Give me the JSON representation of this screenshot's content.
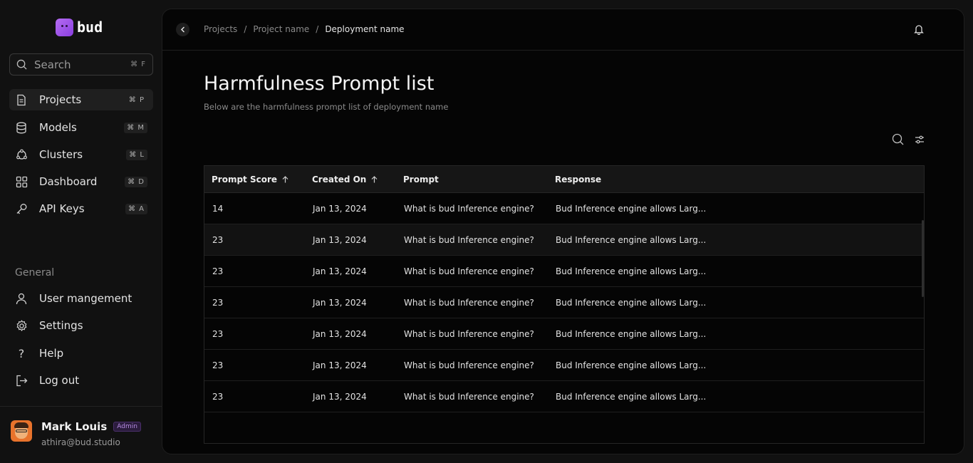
{
  "app": {
    "logo_text": "bud"
  },
  "sidebar": {
    "search": {
      "label": "Search",
      "shortcut": "⌘ F"
    },
    "items": [
      {
        "label": "Projects",
        "shortcut": "⌘ P",
        "icon": "document-icon",
        "active": true
      },
      {
        "label": "Models",
        "shortcut": "⌘ M",
        "icon": "database-icon"
      },
      {
        "label": "Clusters",
        "shortcut": "⌘ L",
        "icon": "cluster-icon"
      },
      {
        "label": "Dashboard",
        "shortcut": "⌘ D",
        "icon": "grid-icon"
      },
      {
        "label": "API Keys",
        "shortcut": "⌘ A",
        "icon": "key-icon"
      }
    ],
    "section_label": "General",
    "general_items": [
      {
        "label": "User mangement",
        "icon": "user-icon"
      },
      {
        "label": "Settings",
        "icon": "gear-icon"
      },
      {
        "label": "Help",
        "icon": "question-icon"
      },
      {
        "label": "Log out",
        "icon": "logout-icon"
      }
    ],
    "profile": {
      "name": "Mark Louis",
      "role": "Admin",
      "email": "athira@bud.studio"
    }
  },
  "header": {
    "breadcrumb": [
      "Projects",
      "Project name",
      "Deployment name"
    ],
    "separator": "/"
  },
  "main": {
    "title": "Harmfulness Prompt list",
    "subtitle": "Below are the harmfulness prompt list of deployment name"
  },
  "table": {
    "columns": [
      "Prompt Score",
      "Created On",
      "Prompt",
      "Response"
    ],
    "rows": [
      [
        "14",
        "Jan 13, 2024",
        "What is bud Inference engine?",
        "Bud Inference engine allows Larg..."
      ],
      [
        "23",
        "Jan 13, 2024",
        "What is bud Inference engine?",
        "Bud Inference engine allows Larg..."
      ],
      [
        "23",
        "Jan 13, 2024",
        "What is bud Inference engine?",
        "Bud Inference engine allows Larg..."
      ],
      [
        "23",
        "Jan 13, 2024",
        "What is bud Inference engine?",
        "Bud Inference engine allows Larg..."
      ],
      [
        "23",
        "Jan 13, 2024",
        "What is bud Inference engine?",
        "Bud Inference engine allows Larg..."
      ],
      [
        "23",
        "Jan 13, 2024",
        "What is bud Inference engine?",
        "Bud Inference engine allows Larg..."
      ],
      [
        "23",
        "Jan 13, 2024",
        "What is bud Inference engine?",
        "Bud Inference engine allows Larg..."
      ]
    ]
  },
  "colors": {
    "accent": "#9B4DEB",
    "background": "#111111",
    "panel": "#050505"
  }
}
